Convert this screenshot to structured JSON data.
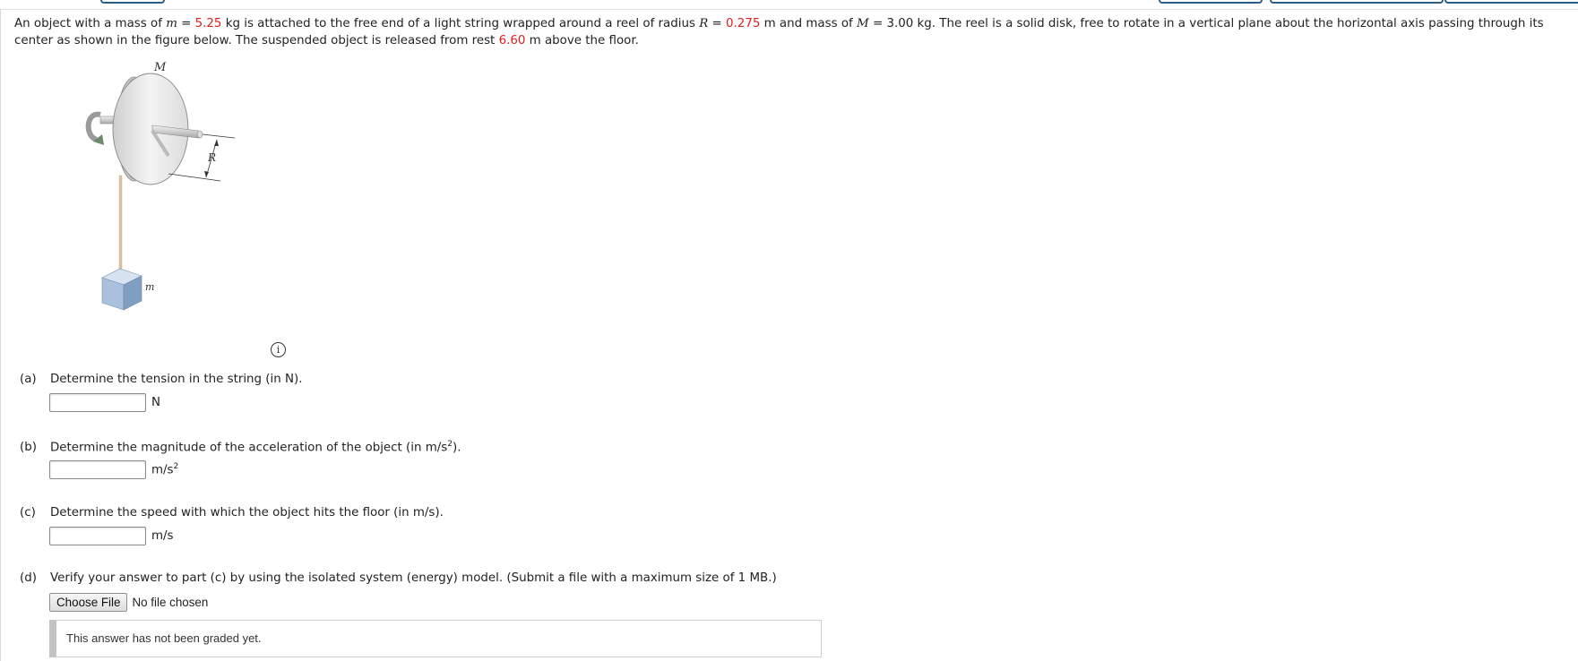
{
  "question": {
    "p1": "An object with a mass of ",
    "m_sym": "m",
    "eq1": " = ",
    "m_val": "5.25",
    "p2": " kg is attached to the free end of a light string wrapped around a reel of radius ",
    "R_sym": "R",
    "eq2": " = ",
    "R_val": "0.275",
    "p3": " m and mass of ",
    "M_sym": "M",
    "p4": " = 3.00 kg. The reel is a solid disk, free to rotate in a vertical plane about the horizontal axis passing through its center as shown in the figure below. The suspended object is released from rest ",
    "h_val": "6.60",
    "p5": " m above the floor."
  },
  "figure": {
    "label_M": "M",
    "label_R": "R",
    "label_m": "m"
  },
  "info_glyph": "i",
  "parts": {
    "a": {
      "label": "(a)",
      "prompt": "Determine the tension in the string (in N).",
      "value": "",
      "unit": "N"
    },
    "b": {
      "label": "(b)",
      "prompt": "Determine the magnitude of the acceleration of the object (in m/s",
      "prompt_sup": "2",
      "prompt_end": ").",
      "value": "",
      "unit": "m/s",
      "unit_sup": "2"
    },
    "c": {
      "label": "(c)",
      "prompt": "Determine the speed with which the object hits the floor (in m/s).",
      "value": "",
      "unit": "m/s"
    },
    "d": {
      "label": "(d)",
      "prompt": "Verify your answer to part (c) by using the isolated system (energy) model. (Submit a file with a maximum size of 1 MB.)",
      "button": "Choose File",
      "file_status": "No file chosen"
    }
  },
  "graded_note": "This answer has not been graded yet."
}
